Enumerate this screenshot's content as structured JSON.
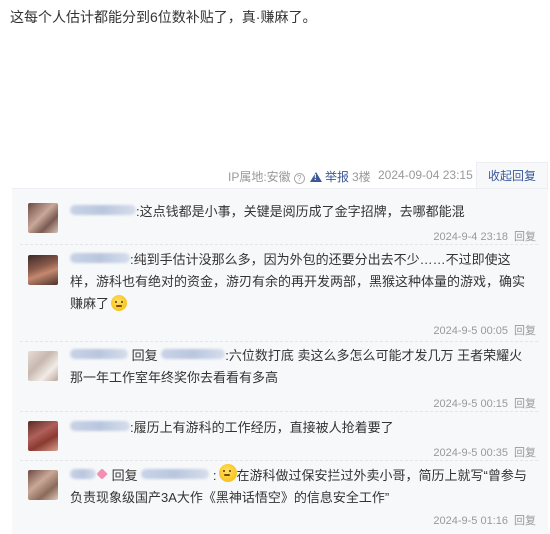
{
  "post": {
    "text": "这每个人估计都能分到6位数补贴了，真·赚麻了。"
  },
  "meta": {
    "ip_label": "IP属地:安徽",
    "report_label": "举报",
    "floor": "3楼",
    "time": "2024-09-04 23:15",
    "collapse_label": "收起回复"
  },
  "replies": [
    {
      "name_width_hint": "short",
      "reply_to": "",
      "text": ":这点钱都是小事，关键是阅历成了金字招牌，去哪都能混",
      "emoji": false,
      "time": "2024-9-4 23:18",
      "reply_label": "回复"
    },
    {
      "reply_to": "",
      "text_line1": ":纯到手估计没那么多，因为外包的还要分出去不少……不过即使这",
      "text_line2": "样，游科也有绝对的资金，游刃有余的再开发两部，黑猴这种体量的游戏，确实",
      "text_line3": "赚麻了",
      "emoji": true,
      "time": "2024-9-5 00:05",
      "reply_label": "回复"
    },
    {
      "reply_word": "回复",
      "text_line1": ":六位数打底 卖这么多怎么可能才发几万 王者荣耀火",
      "text_line2": "那一年工作室年终奖你去看看有多高",
      "time": "2024-9-5 00:15",
      "reply_label": "回复"
    },
    {
      "text": ":履历上有游科的工作经历，直接被人抢着要了",
      "time": "2024-9-5 00:35",
      "reply_label": "回复"
    },
    {
      "reply_word": "回复",
      "text_line1": "在游科做过保安拦过外卖小哥，简历上就写“曾参与",
      "text_line2": "负责现象级国产3A大作《黑神话悟空》的信息安全工作”",
      "time": "2024-9-5 01:16",
      "reply_label": "回复"
    }
  ],
  "colors": {
    "link": "#3b5998",
    "muted": "#999999",
    "reply_bg": "#f7f8fa"
  }
}
